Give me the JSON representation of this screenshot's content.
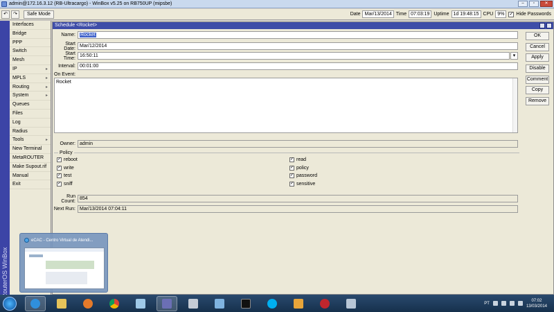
{
  "window": {
    "title": "admin@172.16.3.12 (RB-Ultracargo) - WinBox v5.25 on RB750UP (mipsbe)",
    "buttons": [
      "–",
      "▫",
      "✕"
    ]
  },
  "toolbar": {
    "undo": "↶",
    "redo": "↷",
    "safe_mode": "Safe Mode",
    "date_label": "Date",
    "date_value": "Mar/13/2014",
    "time_label": "Time",
    "time_value": "07:03:19",
    "uptime_label": "Uptime",
    "uptime_value": "1d 19:48:15",
    "cpu_label": "CPU",
    "cpu_value": "9%",
    "hide_passwords_label": "Hide Passwords",
    "hide_passwords_checked": "✓"
  },
  "brand": {
    "vertical_text": "RouterOS WinBox"
  },
  "menu": {
    "items": [
      {
        "label": "Interfaces",
        "arrow": ""
      },
      {
        "label": "Bridge",
        "arrow": ""
      },
      {
        "label": "PPP",
        "arrow": ""
      },
      {
        "label": "Switch",
        "arrow": ""
      },
      {
        "label": "Mesh",
        "arrow": ""
      },
      {
        "label": "IP",
        "arrow": "▸"
      },
      {
        "label": "MPLS",
        "arrow": "▸"
      },
      {
        "label": "Routing",
        "arrow": "▸"
      },
      {
        "label": "System",
        "arrow": "▸"
      },
      {
        "label": "Queues",
        "arrow": ""
      },
      {
        "label": "Files",
        "arrow": ""
      },
      {
        "label": "Log",
        "arrow": ""
      },
      {
        "label": "Radius",
        "arrow": ""
      },
      {
        "label": "Tools",
        "arrow": "▸"
      },
      {
        "label": "New Terminal",
        "arrow": ""
      },
      {
        "label": "MetaROUTER",
        "arrow": ""
      },
      {
        "label": "Make Supout.rif",
        "arrow": ""
      },
      {
        "label": "Manual",
        "arrow": ""
      },
      {
        "label": "Exit",
        "arrow": ""
      }
    ]
  },
  "schedule": {
    "title": "Schedule <Rocket>",
    "fields": {
      "name_label": "Name:",
      "name_value": "Rocket",
      "start_date_label": "Start Date:",
      "start_date_value": "Mar/12/2014",
      "start_time_label": "Start Time:",
      "start_time_value": "16:50:11",
      "interval_label": "Interval:",
      "interval_value": "00:01:00",
      "on_event_label": "On Event:",
      "on_event_value": "Rocket",
      "owner_label": "Owner:",
      "owner_value": "admin",
      "run_count_label": "Run Count:",
      "run_count_value": "854",
      "next_run_label": "Next Run:",
      "next_run_value": "Mar/13/2014 07:04:11"
    },
    "policy": {
      "group_label": "Policy",
      "left": [
        "reboot",
        "write",
        "test",
        "sniff"
      ],
      "right": [
        "read",
        "policy",
        "password",
        "sensitive"
      ],
      "check": "✓"
    },
    "buttons": {
      "ok": "OK",
      "cancel": "Cancel",
      "apply": "Apply",
      "disable": "Disable",
      "comment": "Comment",
      "copy": "Copy",
      "remove": "Remove"
    }
  },
  "thumbnail": {
    "title": "eCAC - Centro Virtual de Atendi..."
  },
  "taskbar": {
    "lang": "PT",
    "time": "07:02",
    "date": "13/03/2014"
  },
  "colors": {
    "accent": "#3e4da8",
    "brand_strip": "#3c44a6",
    "taskbar": "#16304c"
  }
}
